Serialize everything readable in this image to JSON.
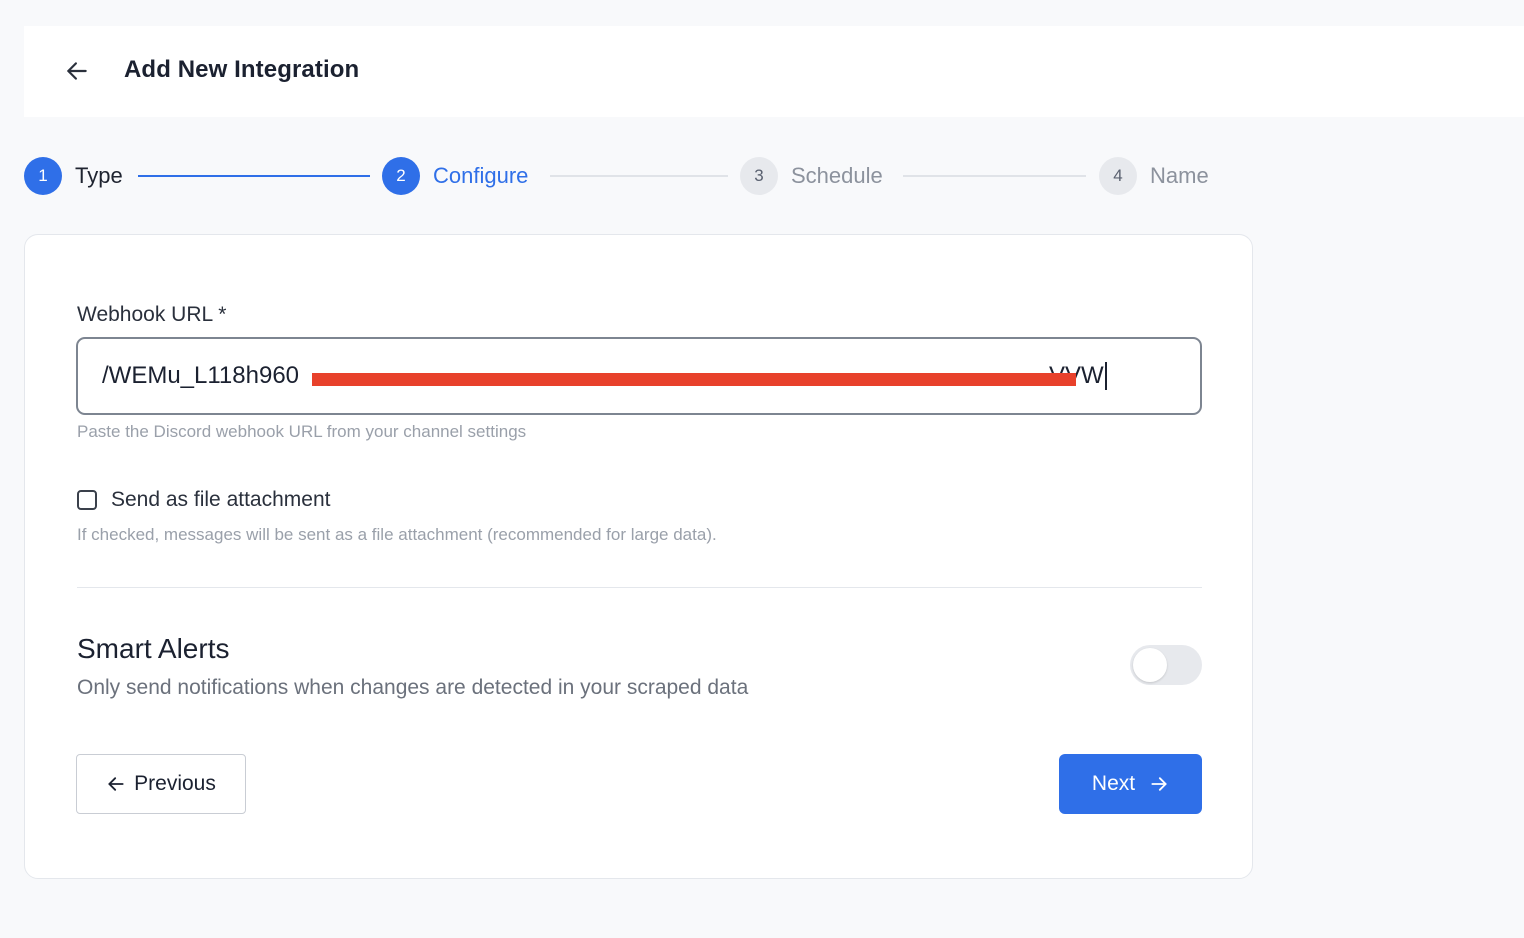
{
  "header": {
    "back_icon": "arrow-left-icon",
    "title": "Add New Integration"
  },
  "stepper": {
    "steps": [
      {
        "number": "1",
        "label": "Type",
        "state": "done"
      },
      {
        "number": "2",
        "label": "Configure",
        "state": "current"
      },
      {
        "number": "3",
        "label": "Schedule",
        "state": "todo"
      },
      {
        "number": "4",
        "label": "Name",
        "state": "todo"
      }
    ]
  },
  "form": {
    "webhook_label": "Webhook URL *",
    "webhook_value_visible_start": "/WEMu_L118h960",
    "webhook_value_visible_end": "VVW",
    "webhook_helper": "Paste the Discord webhook URL from your channel settings",
    "attachment_label": "Send as file attachment",
    "attachment_checked": false,
    "attachment_helper": "If checked, messages will be sent as a file attachment (recommended for large data)."
  },
  "smart_alerts": {
    "title": "Smart Alerts",
    "description": "Only send notifications when changes are detected in your scraped data",
    "enabled": false
  },
  "actions": {
    "previous_label": "Previous",
    "next_label": "Next"
  },
  "colors": {
    "accent": "#2f6fe8",
    "redaction": "#e8412b"
  }
}
